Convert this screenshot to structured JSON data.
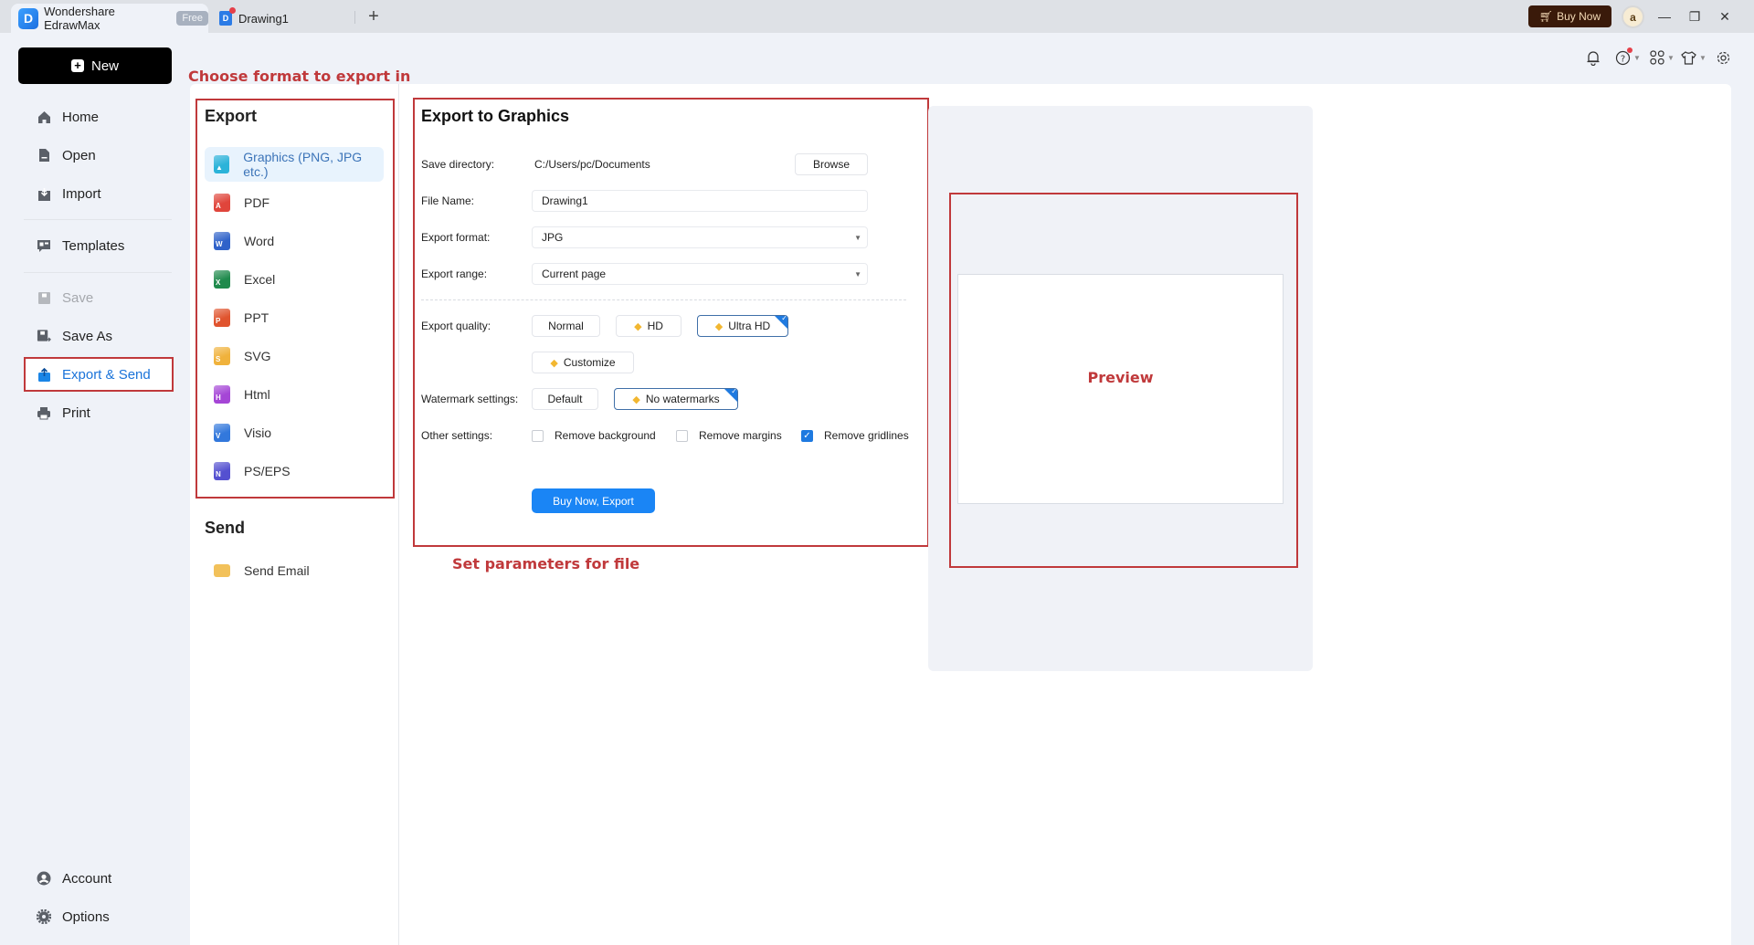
{
  "titlebar": {
    "app_title": "Wondershare EdrawMax",
    "plan_badge": "Free",
    "document_tab": "Drawing1",
    "new_tab": "+",
    "buy_now": "Buy Now",
    "avatar_initial": "a",
    "minimize": "—",
    "restore": "❐",
    "close": "✕"
  },
  "toolbar": {
    "icons": [
      "bell-icon",
      "help-icon",
      "apps-icon",
      "theme-icon",
      "settings-icon"
    ]
  },
  "sidebar": {
    "new_button": "New",
    "items": [
      {
        "label": "Home",
        "icon": "home-icon"
      },
      {
        "label": "Open",
        "icon": "open-file-icon"
      },
      {
        "label": "Import",
        "icon": "import-icon"
      },
      {
        "label": "Templates",
        "icon": "templates-icon"
      },
      {
        "label": "Save",
        "icon": "save-icon",
        "disabled": true
      },
      {
        "label": "Save As",
        "icon": "save-as-icon"
      },
      {
        "label": "Export & Send",
        "icon": "export-icon",
        "active": true
      },
      {
        "label": "Print",
        "icon": "print-icon"
      }
    ],
    "bottom_items": [
      {
        "label": "Account",
        "icon": "account-icon"
      },
      {
        "label": "Options",
        "icon": "options-icon"
      }
    ]
  },
  "annotations": {
    "choose_format": "Choose format to export in",
    "set_parameters": "Set parameters for file",
    "preview": "Preview"
  },
  "export_panel": {
    "title": "Export",
    "formats": [
      {
        "label": "Graphics (PNG, JPG etc.)",
        "icon": "graphics-file-icon",
        "color": "#2bb3d9",
        "selected": true
      },
      {
        "label": "PDF",
        "icon": "pdf-file-icon",
        "color": "#e0453b"
      },
      {
        "label": "Word",
        "icon": "word-file-icon",
        "color": "#2f62c9"
      },
      {
        "label": "Excel",
        "icon": "excel-file-icon",
        "color": "#1f8a4c"
      },
      {
        "label": "PPT",
        "icon": "ppt-file-icon",
        "color": "#e0542e"
      },
      {
        "label": "SVG",
        "icon": "svg-file-icon",
        "color": "#f0b23c"
      },
      {
        "label": "Html",
        "icon": "html-file-icon",
        "color": "#a546d6"
      },
      {
        "label": "Visio",
        "icon": "visio-file-icon",
        "color": "#3278dc"
      },
      {
        "label": "PS/EPS",
        "icon": "ps-eps-file-icon",
        "color": "#5450d0"
      }
    ],
    "send_title": "Send",
    "send_items": [
      {
        "label": "Send Email",
        "icon": "email-icon",
        "color": "#f2c15a"
      }
    ]
  },
  "form": {
    "title": "Export to Graphics",
    "save_directory_label": "Save directory:",
    "save_directory_value": "C:/Users/pc/Documents",
    "browse_button": "Browse",
    "file_name_label": "File Name:",
    "file_name_value": "Drawing1",
    "export_format_label": "Export format:",
    "export_format_value": "JPG",
    "export_range_label": "Export range:",
    "export_range_value": "Current page",
    "quality_label": "Export quality:",
    "quality_options": [
      {
        "label": "Normal",
        "premium": false,
        "selected": false
      },
      {
        "label": "HD",
        "premium": true,
        "selected": false
      },
      {
        "label": "Ultra HD",
        "premium": true,
        "selected": true
      },
      {
        "label": "Customize",
        "premium": true,
        "selected": false
      }
    ],
    "watermark_label": "Watermark settings:",
    "watermark_options": [
      {
        "label": "Default",
        "premium": false,
        "selected": false
      },
      {
        "label": "No watermarks",
        "premium": true,
        "selected": true
      }
    ],
    "other_label": "Other settings:",
    "other_options": [
      {
        "label": "Remove background",
        "checked": false
      },
      {
        "label": "Remove margins",
        "checked": false
      },
      {
        "label": "Remove gridlines",
        "checked": true
      }
    ],
    "submit_button": "Buy Now, Export"
  },
  "colors": {
    "accent": "#1a85f5",
    "annotation_red": "#c0393b",
    "buy_now_bg": "#3a1a0a"
  }
}
